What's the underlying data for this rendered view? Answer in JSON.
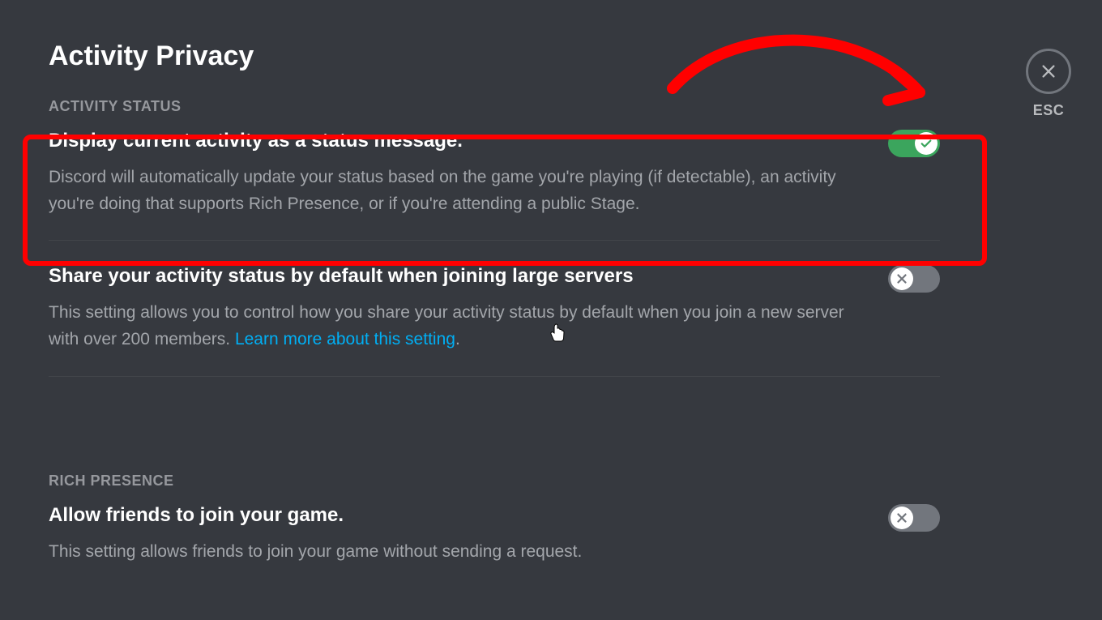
{
  "page": {
    "title": "Activity Privacy"
  },
  "close": {
    "label": "ESC"
  },
  "sections": {
    "activity_status": {
      "header": "ACTIVITY STATUS",
      "settings": [
        {
          "title": "Display current activity as a status message.",
          "description": "Discord will automatically update your status based on the game you're playing (if detectable), an activity you're doing that supports Rich Presence, or if you're attending a public Stage.",
          "toggle": true
        },
        {
          "title": "Share your activity status by default when joining large servers",
          "description_prefix": "This setting allows you to control how you share your activity status by default when you join a new server with over 200 members. ",
          "link_text": "Learn more about this setting",
          "description_suffix": ".",
          "toggle": false
        }
      ]
    },
    "rich_presence": {
      "header": "RICH PRESENCE",
      "settings": [
        {
          "title": "Allow friends to join your game.",
          "description": "This setting allows friends to join your game without sending a request.",
          "toggle": false
        }
      ]
    }
  },
  "annotations": {
    "highlight": "red-box-around-first-setting",
    "arrow": "red-arrow-pointing-to-close"
  }
}
